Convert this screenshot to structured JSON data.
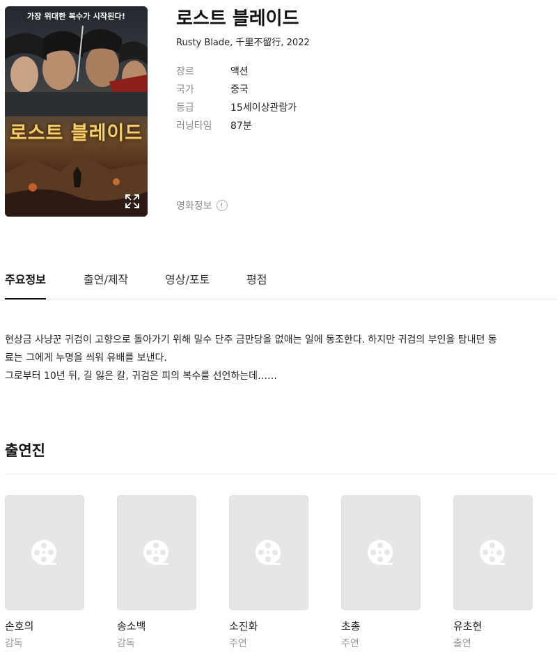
{
  "poster": {
    "tagline": "가장 위대한 복수가 시작된다!",
    "title_art": "로스트 블레이드",
    "expand_icon": "expand-icon"
  },
  "movie": {
    "title": "로스트 블레이드",
    "subtitle": "Rusty Blade, 千里不留行, 2022",
    "info": [
      {
        "label": "장르",
        "value": "액션"
      },
      {
        "label": "국가",
        "value": "중국"
      },
      {
        "label": "등급",
        "value": "15세이상관람가"
      },
      {
        "label": "러닝타임",
        "value": "87분"
      }
    ],
    "movie_info_label": "영화정보",
    "movie_info_icon": "!"
  },
  "tabs": [
    {
      "label": "주요정보",
      "active": true
    },
    {
      "label": "출연/제작",
      "active": false
    },
    {
      "label": "영상/포토",
      "active": false
    },
    {
      "label": "평점",
      "active": false
    }
  ],
  "synopsis": {
    "line1": "현상금 사냥꾼 귀검이 고향으로 돌아가기 위해 밀수 단주 금만당을 없애는 일에 동조한다. 하지만 귀검의 부인을 탐내던 동",
    "line2": "료는 그에게 누명을 씌워 유배를 보낸다.",
    "line3": "그로부터 10년 뒤, 길 잃은 칼, 귀검은 피의 복수를 선언하는데……"
  },
  "cast": {
    "heading": "출연진",
    "placeholder_icon": "film-reel-icon",
    "members": [
      {
        "name": "손호의",
        "role": "감독"
      },
      {
        "name": "송소백",
        "role": "감독"
      },
      {
        "name": "소진화",
        "role": "주연"
      },
      {
        "name": "초총",
        "role": "주연"
      },
      {
        "name": "유초현",
        "role": "출연"
      }
    ]
  }
}
